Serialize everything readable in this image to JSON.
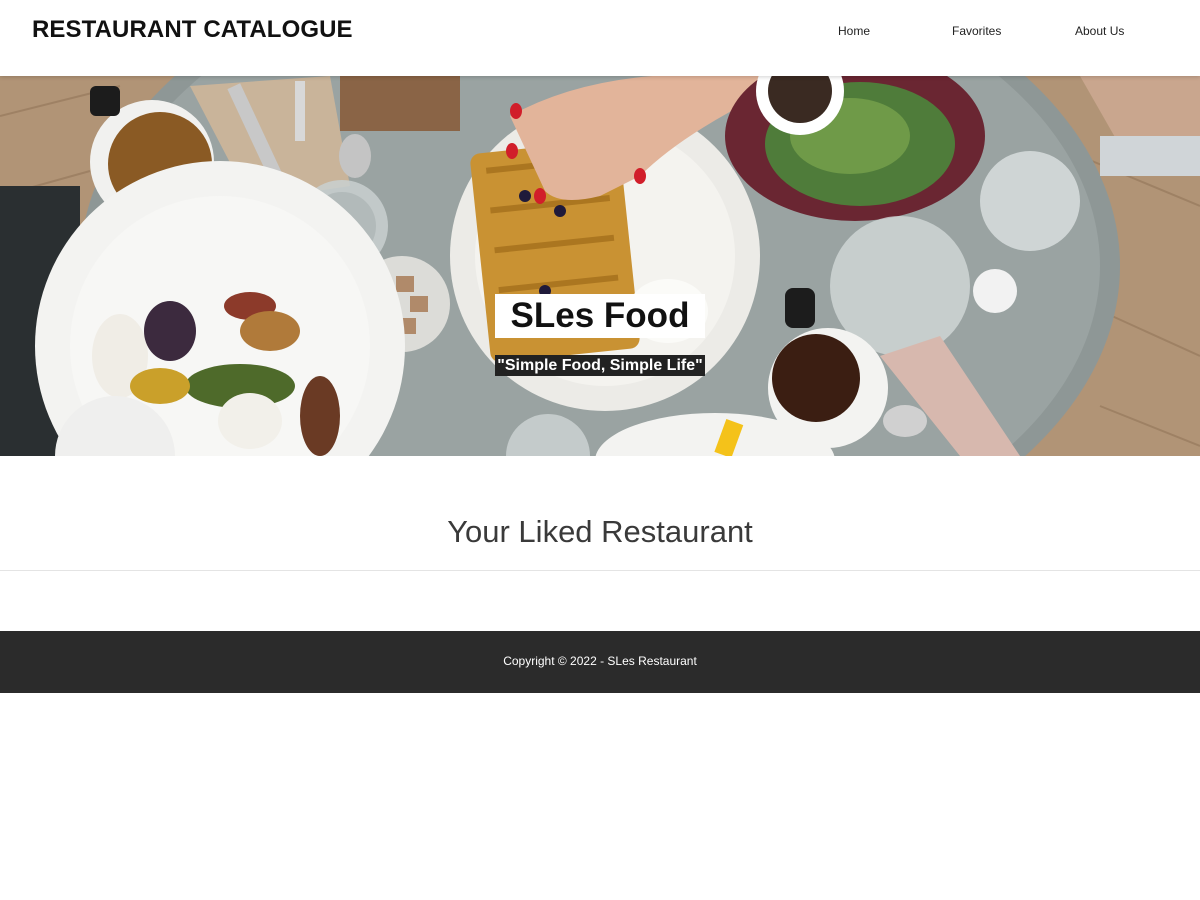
{
  "header": {
    "brand": "RESTAURANT CATALOGUE",
    "nav": [
      {
        "label": "Home"
      },
      {
        "label": "Favorites"
      },
      {
        "label": "About Us"
      }
    ]
  },
  "hero": {
    "title": "SLes Food",
    "tagline": "\"Simple Food, Simple Life\""
  },
  "main": {
    "heading": "Your Liked Restaurant"
  },
  "footer": {
    "copyright": "Copyright © 2022 - SLes Restaurant"
  },
  "colors": {
    "footer_bg": "#2b2b2b",
    "tagline_bg": "#222222",
    "title_bg": "#ffffff"
  }
}
